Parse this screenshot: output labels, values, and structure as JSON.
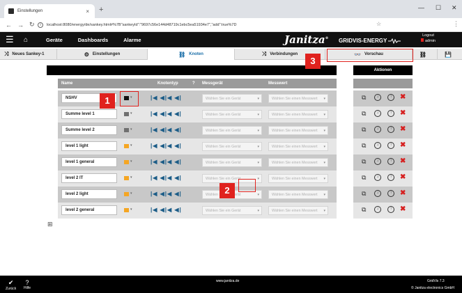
{
  "browser": {
    "tab_title": "Einstellungen",
    "tab_close": "×",
    "new_tab": "+",
    "url": "localhost:8080/energy/de/sankey.html#%7B\"sankeyId\":\"9697c56e144d48719c1ebc5ea51934e7\",\"add\":true%7D",
    "min": "—",
    "max": "☐",
    "close": "✕"
  },
  "header": {
    "nav": [
      "Geräte",
      "Dashboards",
      "Alarme"
    ],
    "logo": "Janitza",
    "logo_mark": "®",
    "product": "GRIDVIS-ENERGY",
    "logout": "Logout",
    "user": "admin"
  },
  "toolbar": {
    "project": "Neues Sankey-1",
    "settings": "Einstellungen",
    "nodes": "Knoten",
    "connections": "Verbindungen",
    "preview": "Vorschau"
  },
  "table": {
    "col_name": "Name",
    "col_type": "Knotentyp",
    "col_device": "Messgerät",
    "col_value": "Messwert",
    "actions_title": "Aktionen",
    "device_placeholder": "Wählen Sie ein Gerät",
    "value_placeholder": "Wählen Sie einen Messwert",
    "rows": [
      {
        "name": "NSHV",
        "color": "#111111"
      },
      {
        "name": "Summe level 1",
        "color": "#707070"
      },
      {
        "name": "Summe level 2",
        "color": "#707070"
      },
      {
        "name": "level 1 light",
        "color": "#f5a623"
      },
      {
        "name": "level 1 general",
        "color": "#f5a623"
      },
      {
        "name": "level 2 IT",
        "color": "#f5a623"
      },
      {
        "name": "level 2 light",
        "color": "#f5a623"
      },
      {
        "name": "level 2 general",
        "color": "#f5a623"
      }
    ]
  },
  "callouts": {
    "one": "1",
    "two": "2",
    "three": "3"
  },
  "footer": {
    "back": "Zurück",
    "help": "Hilfe",
    "site": "www.janitza.de",
    "version": "GridVis 7.3",
    "copyright": "© Janitza electronics GmbH"
  },
  "colors": {
    "accent_red": "#e0221e",
    "link_blue": "#1a6ea8"
  }
}
